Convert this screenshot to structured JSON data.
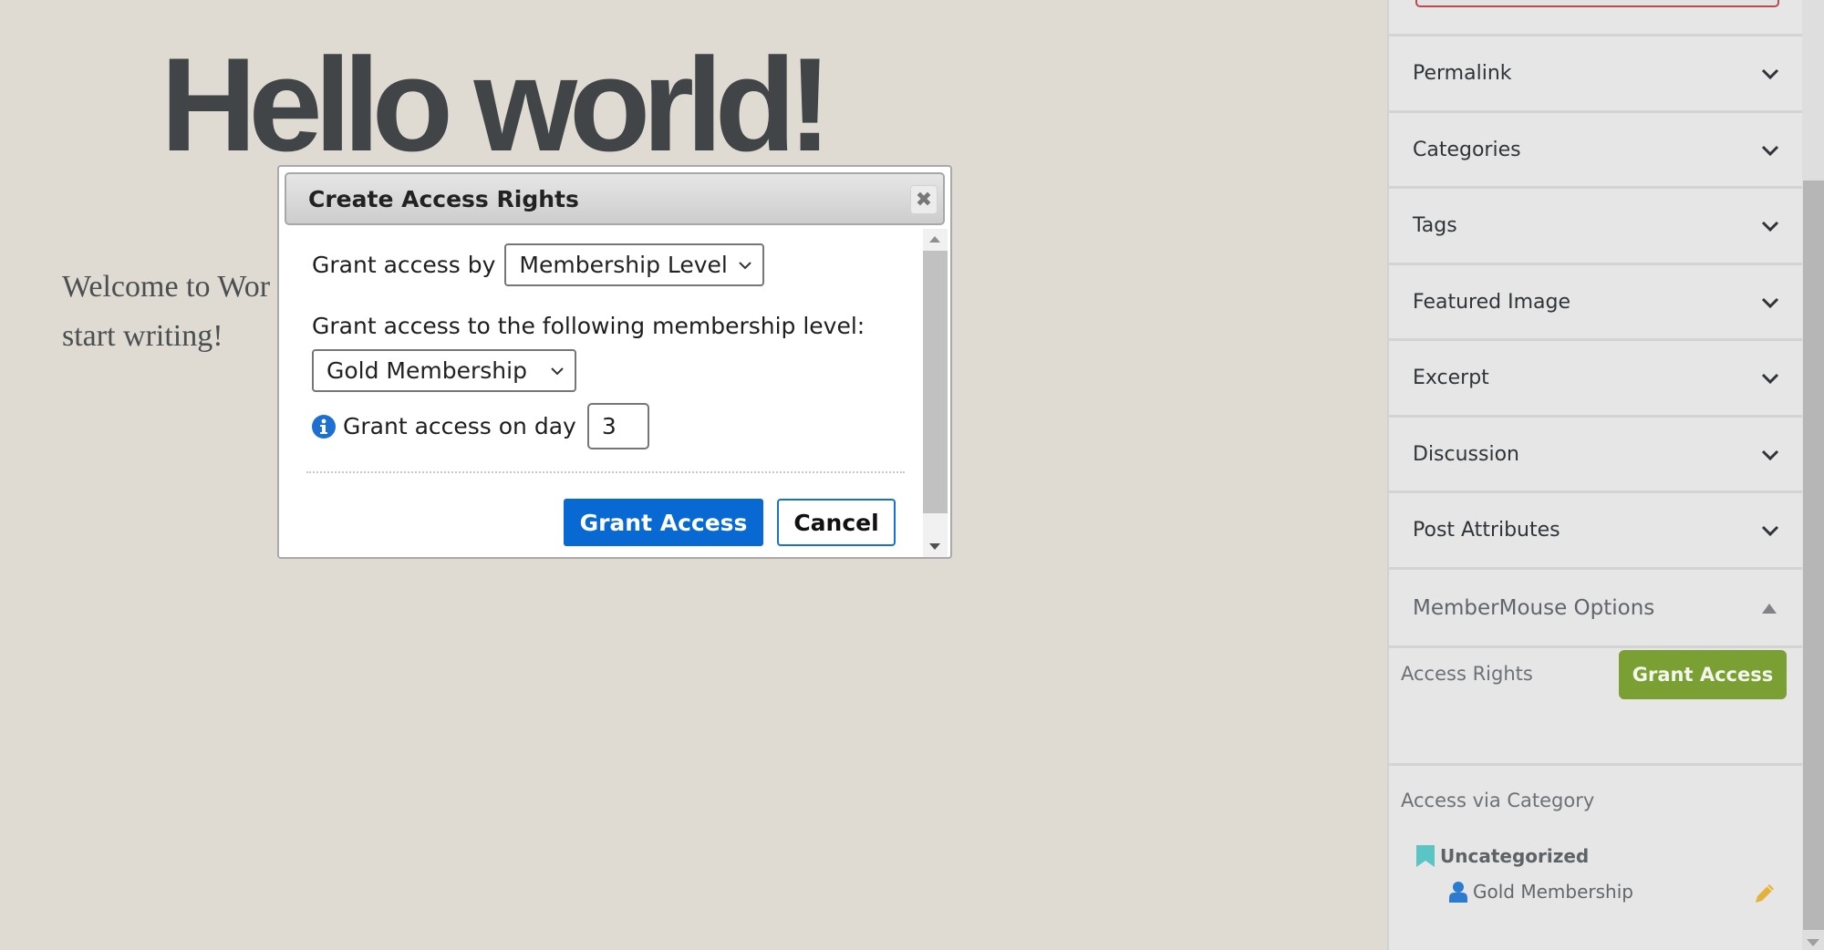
{
  "editor": {
    "post_title": "Hello world!",
    "post_body_line1": "Welcome to Wor",
    "post_body_line2": "start writing!"
  },
  "sidebar": {
    "panels": [
      {
        "label": "Permalink",
        "icon": "chevron-down-icon"
      },
      {
        "label": "Categories",
        "icon": "chevron-down-icon"
      },
      {
        "label": "Tags",
        "icon": "chevron-down-icon"
      },
      {
        "label": "Featured Image",
        "icon": "chevron-down-icon"
      },
      {
        "label": "Excerpt",
        "icon": "chevron-down-icon"
      },
      {
        "label": "Discussion",
        "icon": "chevron-down-icon"
      },
      {
        "label": "Post Attributes",
        "icon": "chevron-down-icon"
      }
    ],
    "membermouse": {
      "title": "MemberMouse Options",
      "icon": "triangle-up-icon",
      "access_rights_label": "Access Rights",
      "grant_access_button": "Grant Access",
      "grant_access_color": "#7aa033",
      "access_via_category_label": "Access via Category",
      "category": {
        "name": "Uncategorized",
        "icon": "bookmark-icon",
        "icon_color": "#5bc4c4",
        "membership": {
          "name": "Gold Membership",
          "icon": "user-icon",
          "icon_color": "#2b7bd1",
          "edit_icon": "pencil-icon",
          "edit_icon_color": "#e2b23c"
        }
      }
    }
  },
  "dialog": {
    "title": "Create Access Rights",
    "close_icon": "close-icon",
    "grant_by_label": "Grant access by",
    "grant_by_value": "Membership Level",
    "level_label": "Grant access to the following membership level:",
    "level_value": "Gold Membership",
    "day_label": "Grant access on day",
    "day_value": "3",
    "info_icon": "info-icon",
    "info_icon_color": "#1d6fd1",
    "grant_button": "Grant Access",
    "grant_button_color": "#0969d3",
    "cancel_button": "Cancel"
  }
}
